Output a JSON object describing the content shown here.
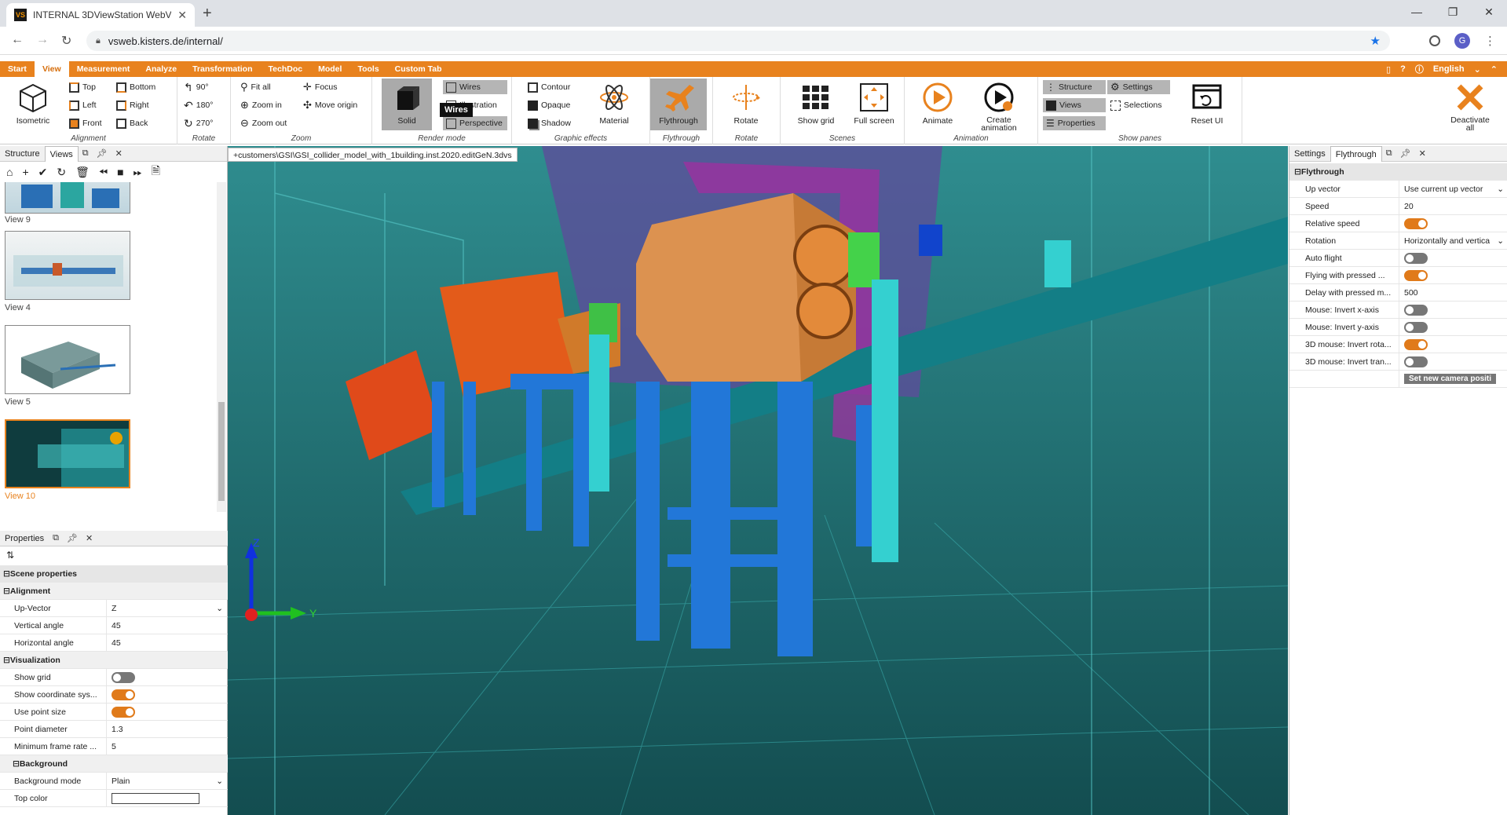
{
  "browser": {
    "tab_title": "INTERNAL 3DViewStation WebVi",
    "url": "vsweb.kisters.de/internal/",
    "avatar_letter": "G"
  },
  "menubar": {
    "items": [
      "Start",
      "View",
      "Measurement",
      "Analyze",
      "Transformation",
      "TechDoc",
      "Model",
      "Tools",
      "Custom Tab"
    ],
    "active": "View",
    "language": "English"
  },
  "ribbon": {
    "alignment": {
      "label": "Alignment",
      "isometric": "Isometric",
      "top": "Top",
      "bottom": "Bottom",
      "left": "Left",
      "right": "Right",
      "front": "Front",
      "back": "Back"
    },
    "rotate1": {
      "label": "Rotate",
      "r90": "90°",
      "r180": "180°",
      "r270": "270°"
    },
    "zoom": {
      "label": "Zoom",
      "fit_all": "Fit all",
      "focus": "Focus",
      "zoom_in": "Zoom in",
      "move_origin": "Move origin",
      "zoom_out": "Zoom out"
    },
    "render_mode": {
      "label": "Render mode",
      "solid": "Solid",
      "wires": "Wires",
      "illustration": "Illustration",
      "perspective": "Perspective"
    },
    "graphic_effects": {
      "label": "Graphic effects",
      "contour": "Contour",
      "opaque": "Opaque",
      "shadow": "Shadow",
      "material": "Material"
    },
    "flythrough": {
      "label": "Flythrough",
      "flythrough": "Flythrough"
    },
    "rotate2": {
      "label": "Rotate",
      "rotate": "Rotate"
    },
    "scenes": {
      "label": "Scenes",
      "show_grid": "Show grid",
      "full_screen": "Full screen"
    },
    "animation": {
      "label": "Animation",
      "animate": "Animate",
      "create_animation_1": "Create",
      "create_animation_2": "animation"
    },
    "show_panes": {
      "label": "Show panes",
      "structure": "Structure",
      "settings": "Settings",
      "views": "Views",
      "selections": "Selections",
      "properties": "Properties",
      "reset_ui": "Reset UI"
    },
    "deactivate_1": "Deactivate",
    "deactivate_2": "all"
  },
  "tooltip": "Wires",
  "left_panel": {
    "tabs": [
      "Structure",
      "Views"
    ],
    "active_tab": "Views",
    "views": [
      "View 9",
      "View 4",
      "View 5",
      "View 10"
    ],
    "selected_view": "View 10"
  },
  "properties": {
    "title": "Properties",
    "rows": [
      {
        "type": "cat",
        "label": "Scene properties"
      },
      {
        "type": "sub",
        "label": "Alignment"
      },
      {
        "type": "kv",
        "label": "Up-Vector",
        "value": "Z",
        "dropdown": true
      },
      {
        "type": "kv",
        "label": "Vertical angle",
        "value": "45"
      },
      {
        "type": "kv",
        "label": "Horizontal angle",
        "value": "45"
      },
      {
        "type": "sub",
        "label": "Visualization"
      },
      {
        "type": "toggle",
        "label": "Show grid",
        "on": false
      },
      {
        "type": "toggle",
        "label": "Show coordinate sys...",
        "on": true
      },
      {
        "type": "toggle",
        "label": "Use point size",
        "on": true
      },
      {
        "type": "kv",
        "label": "Point diameter",
        "value": "1.3"
      },
      {
        "type": "kv",
        "label": "Minimum frame rate ...",
        "value": "5"
      },
      {
        "type": "sub2",
        "label": "Background"
      },
      {
        "type": "kv",
        "label": "Background mode",
        "value": "Plain",
        "dropdown": true
      },
      {
        "type": "color",
        "label": "Top color"
      }
    ]
  },
  "viewport": {
    "file_tab": "+customers\\GSI\\GSI_collider_model_with_1building.inst.2020.editGeN.3dvs",
    "axis_z": "Z",
    "axis_y": "Y"
  },
  "right_panel": {
    "tabs": [
      "Settings",
      "Flythrough"
    ],
    "active_tab": "Flythrough",
    "section": "Flythrough",
    "rows": [
      {
        "type": "kv",
        "label": "Up vector",
        "value": "Use current up vector",
        "dropdown": true
      },
      {
        "type": "kv",
        "label": "Speed",
        "value": "20"
      },
      {
        "type": "toggle",
        "label": "Relative speed",
        "on": true
      },
      {
        "type": "kv",
        "label": "Rotation",
        "value": "Horizontally and vertica",
        "dropdown": true
      },
      {
        "type": "toggle",
        "label": "Auto flight",
        "on": false
      },
      {
        "type": "toggle",
        "label": "Flying with pressed ...",
        "on": true
      },
      {
        "type": "kv",
        "label": "Delay with pressed m...",
        "value": "500"
      },
      {
        "type": "toggle",
        "label": "Mouse: Invert x-axis",
        "on": false
      },
      {
        "type": "toggle",
        "label": "Mouse: Invert y-axis",
        "on": false
      },
      {
        "type": "toggle",
        "label": "3D mouse: Invert rota...",
        "on": true
      },
      {
        "type": "toggle",
        "label": "3D mouse: Invert tran...",
        "on": false
      },
      {
        "type": "button",
        "label": "",
        "value": "Set new camera positi"
      }
    ]
  },
  "colors": {
    "accent": "#e8821e",
    "toggle_on": "#e07a1a"
  }
}
